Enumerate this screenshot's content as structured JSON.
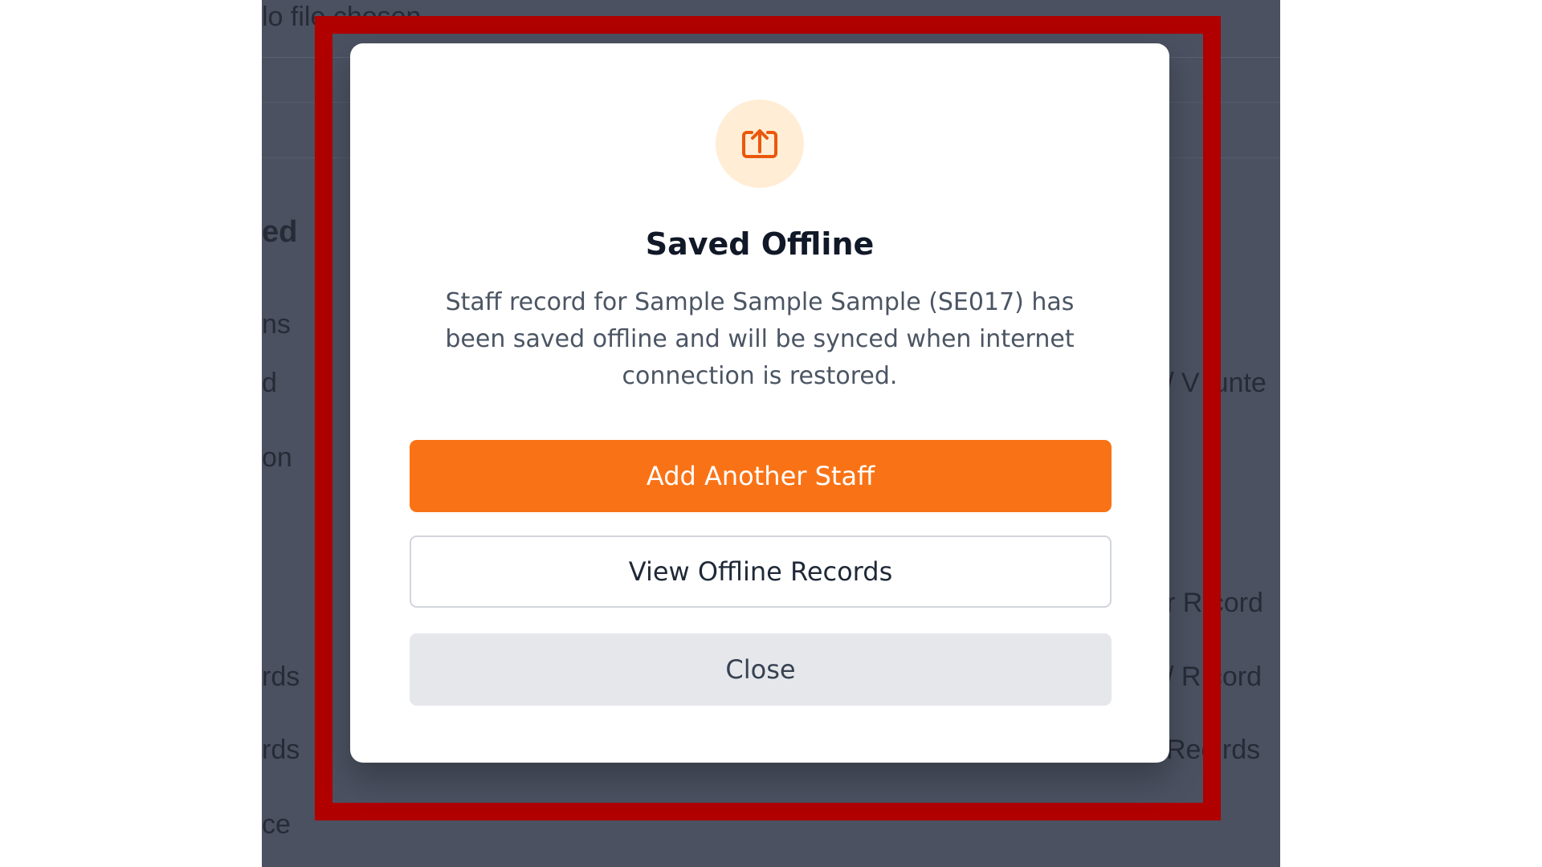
{
  "background": {
    "file_status": "lo file chosen",
    "section_heading": "ed",
    "left_items": [
      "ns",
      "d",
      "on",
      "rds",
      "rds",
      "ce"
    ],
    "right_items": [
      "/ V lunte",
      "r R cord",
      "/ R cord",
      "Rec rds"
    ]
  },
  "modal": {
    "icon": "upload-icon",
    "title": "Saved Offline",
    "message": "Staff record for Sample Sample Sample (SE017) has been saved offline and will be synced when internet connection is restored.",
    "buttons": {
      "add_another": "Add Another Staff",
      "view_offline": "View Offline Records",
      "close": "Close"
    }
  },
  "colors": {
    "accent": "#f97316",
    "icon_bg": "#ffedd5",
    "overlay": "#4b5161",
    "highlight_frame": "#b00000"
  }
}
